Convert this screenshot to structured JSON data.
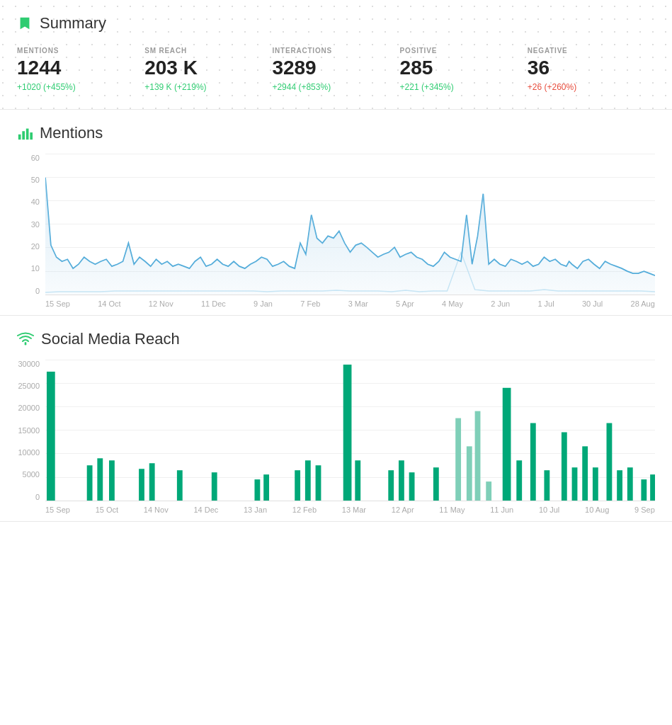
{
  "summary": {
    "title": "Summary",
    "stats": [
      {
        "label": "MENTIONS",
        "value": "1244",
        "change": "+1020 (+455%)",
        "change_type": "positive"
      },
      {
        "label": "SM REACH",
        "value": "203 K",
        "change": "+139 K (+219%)",
        "change_type": "positive"
      },
      {
        "label": "INTERACTIONS",
        "value": "3289",
        "change": "+2944 (+853%)",
        "change_type": "positive"
      },
      {
        "label": "POSITIVE",
        "value": "285",
        "change": "+221 (+345%)",
        "change_type": "positive"
      },
      {
        "label": "NEGATIVE",
        "value": "36",
        "change": "+26 (+260%)",
        "change_type": "negative"
      }
    ]
  },
  "mentions_chart": {
    "title": "Mentions",
    "y_labels": [
      "60",
      "50",
      "40",
      "30",
      "20",
      "10",
      "0"
    ],
    "x_labels": [
      "15 Sep",
      "14 Oct",
      "12 Nov",
      "11 Dec",
      "9 Jan",
      "7 Feb",
      "3 Mar",
      "5 Apr",
      "4 May",
      "2 Jun",
      "1 Jul",
      "30 Jul",
      "28 Aug"
    ]
  },
  "social_reach_chart": {
    "title": "Social Media Reach",
    "y_labels": [
      "30000",
      "25000",
      "20000",
      "15000",
      "10000",
      "5000",
      "0"
    ],
    "x_labels": [
      "15 Sep",
      "15 Oct",
      "14 Nov",
      "14 Dec",
      "13 Jan",
      "12 Feb",
      "13 Mar",
      "12 Apr",
      "11 May",
      "11 Jun",
      "10 Jul",
      "10 Aug",
      "9 Sep"
    ]
  },
  "colors": {
    "green": "#2ecc71",
    "blue": "#4aa8d8",
    "light_blue": "#b8d9ee",
    "teal": "#00a878",
    "light_teal": "#7fcfb8",
    "accent": "#2ecc71"
  }
}
